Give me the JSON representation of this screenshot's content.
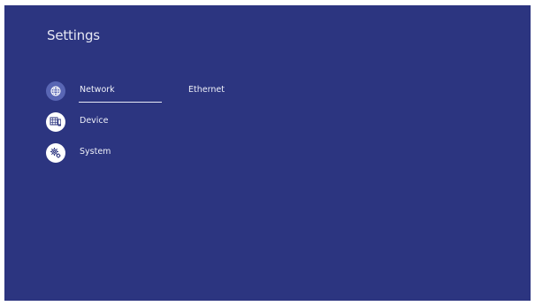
{
  "header": {
    "title": "Settings"
  },
  "menu": {
    "items": [
      {
        "label": "Network",
        "icon": "globe-icon",
        "selected": true
      },
      {
        "label": "Device",
        "icon": "device-icon",
        "selected": false
      },
      {
        "label": "System",
        "icon": "gear-icon",
        "selected": false
      }
    ]
  },
  "detail": {
    "selected_option": "Ethernet"
  },
  "colors": {
    "background": "#2c3580",
    "active_icon_bg": "#5966b4",
    "text": "#eef0f8"
  }
}
